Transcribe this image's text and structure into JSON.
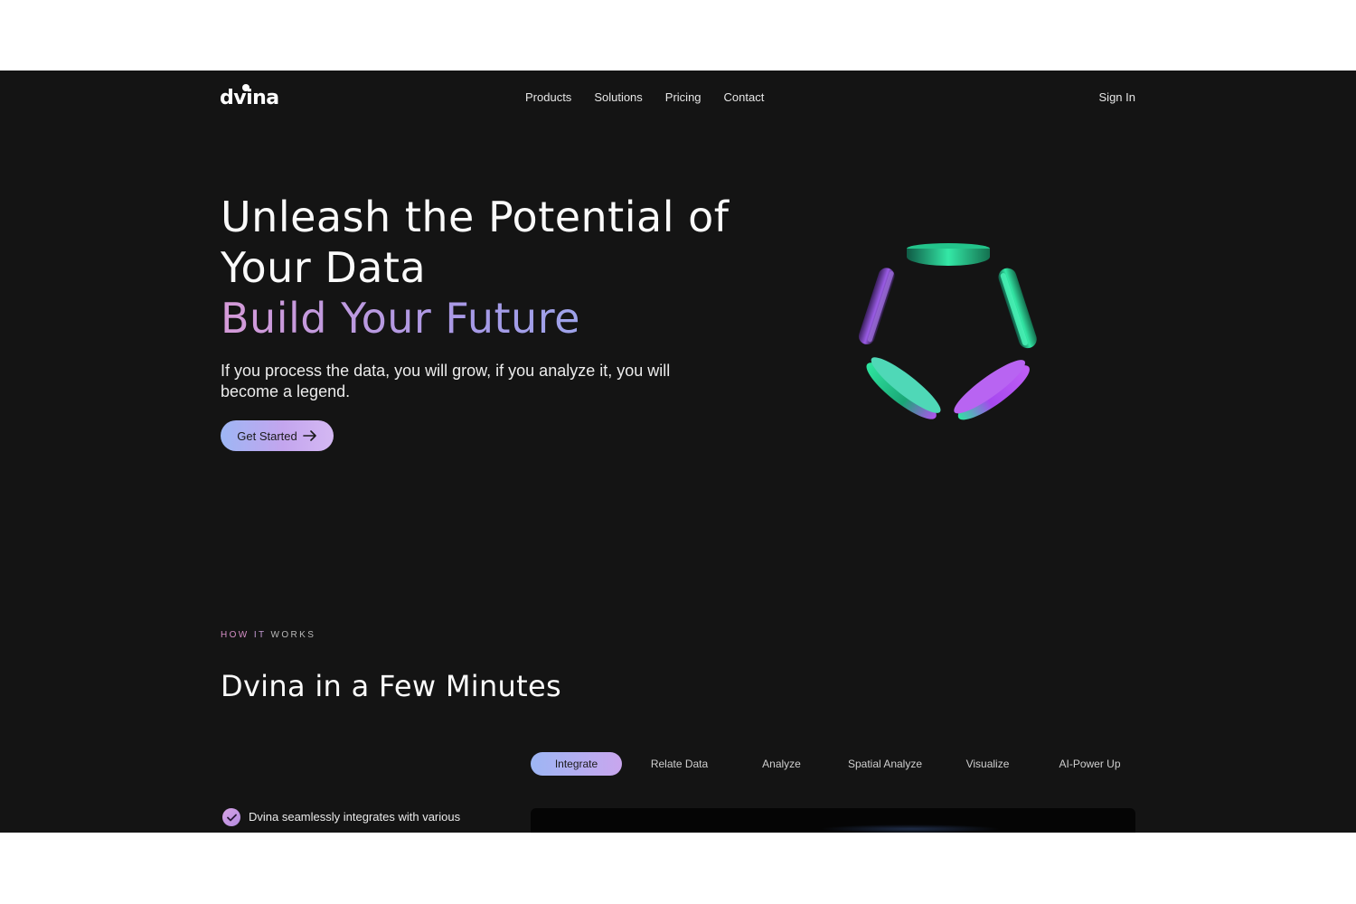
{
  "header": {
    "logo": "dvina",
    "nav": [
      "Products",
      "Solutions",
      "Pricing",
      "Contact"
    ],
    "sign_in": "Sign In"
  },
  "hero": {
    "title_line1": "Unleash the Potential of",
    "title_line2": "Your Data",
    "title_accent": "Build Your Future",
    "subtitle": "If you process the data, you will grow, if you analyze it, you will become a legend.",
    "cta_label": "Get Started"
  },
  "how_it_works": {
    "eyebrow_how": "HOW",
    "eyebrow_it": "IT",
    "eyebrow_works": "WORKS",
    "title": "Dvina in a Few Minutes",
    "tabs": [
      "Integrate",
      "Relate Data",
      "Analyze",
      "Spatial Analyze",
      "Visualize",
      "AI-Power Up"
    ],
    "active_tab": "Integrate",
    "feature_text": "Dvina seamlessly integrates with various"
  },
  "colors": {
    "background": "#141414",
    "accent_pink": "#d59ad8",
    "accent_blue": "#8fb6f2",
    "ring_green": "#2ee6a0",
    "ring_purple": "#a64ff0"
  }
}
